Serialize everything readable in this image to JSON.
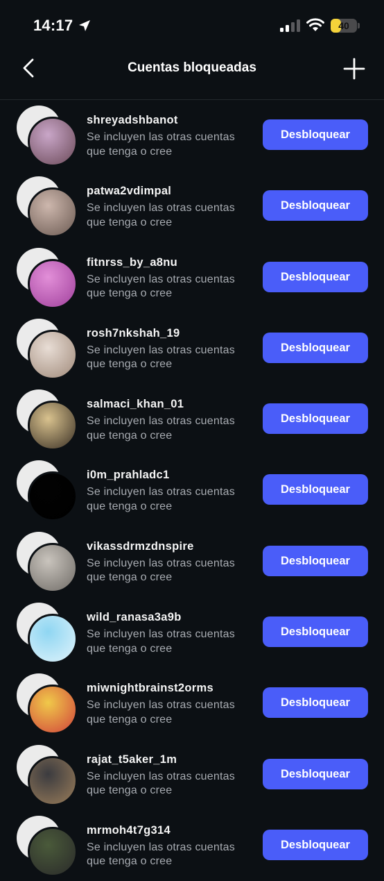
{
  "status_bar": {
    "time": "14:17",
    "battery_level": "40",
    "battery_fraction": 0.4,
    "icons": [
      "location-arrow-icon",
      "cellular-signal-icon",
      "wifi-icon",
      "battery-icon"
    ]
  },
  "nav": {
    "title": "Cuentas bloqueadas",
    "back_icon": "chevron-left-icon",
    "add_icon": "plus-icon"
  },
  "colors": {
    "background": "#0c1014",
    "accent_button": "#4a5df9",
    "secondary_text": "#a8acb2"
  },
  "common": {
    "subtitle": "Se incluyen las otras cuentas que tenga o cree",
    "unblock_label": "Desbloquear"
  },
  "accounts": [
    {
      "username": "shreyadshbanot",
      "avatar_colors": [
        "#c9a6c8",
        "#6b4a58"
      ]
    },
    {
      "username": "patwa2vdimpal",
      "avatar_colors": [
        "#cdb7ad",
        "#6b5a52"
      ]
    },
    {
      "username": "fitnrss_by_a8nu",
      "avatar_colors": [
        "#e28fd8",
        "#a0409c"
      ]
    },
    {
      "username": "rosh7nkshah_19",
      "avatar_colors": [
        "#e8ddd5",
        "#a08a7a"
      ]
    },
    {
      "username": "salmaci_khan_01",
      "avatar_colors": [
        "#d9c28e",
        "#3a3025"
      ]
    },
    {
      "username": "i0m_prahladc1",
      "avatar_colors": [
        "#020202",
        "#000000"
      ]
    },
    {
      "username": "vikassdrmzdnspire",
      "avatar_colors": [
        "#c9c4bd",
        "#6f6b66"
      ]
    },
    {
      "username": "wild_ranasa3a9b",
      "avatar_colors": [
        "#8fd6f2",
        "#e0f3fb"
      ]
    },
    {
      "username": "miwnightbrainst2orms",
      "avatar_colors": [
        "#f0c94a",
        "#d1433b"
      ]
    },
    {
      "username": "rajat_t5aker_1m",
      "avatar_colors": [
        "#3b3b3f",
        "#9a7d5a"
      ]
    },
    {
      "username": "mrmoh4t7g314",
      "avatar_colors": [
        "#4a5a3a",
        "#2a2a2a"
      ]
    }
  ]
}
